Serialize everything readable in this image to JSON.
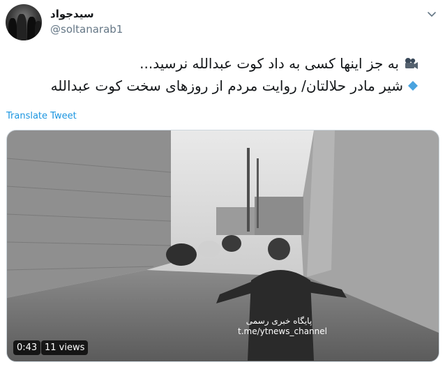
{
  "author": {
    "display_name": "سیدجواد",
    "handle": "@soltanarab1",
    "avatar_icon": "profile-photo"
  },
  "menu_icon": "chevron-down-icon",
  "tweet": {
    "line1": "به جز اینها کسی به داد کوت عبدالله نرسید...",
    "line1_icon": "movie-camera-icon",
    "line2": "شیر مادر حلالتان/ روایت مردم از روزهای سخت کوت عبدالله",
    "line2_icon": "blue-diamond-icon"
  },
  "translate_label": "Translate Tweet",
  "video": {
    "duration": "0:43",
    "views": "11 views",
    "watermark_line1": "پایگاه خبری رسمی",
    "watermark_line2": "t.me/ytnews_channel"
  },
  "colors": {
    "link": "#1b95e0",
    "handle": "#657786",
    "text": "#14171a"
  }
}
